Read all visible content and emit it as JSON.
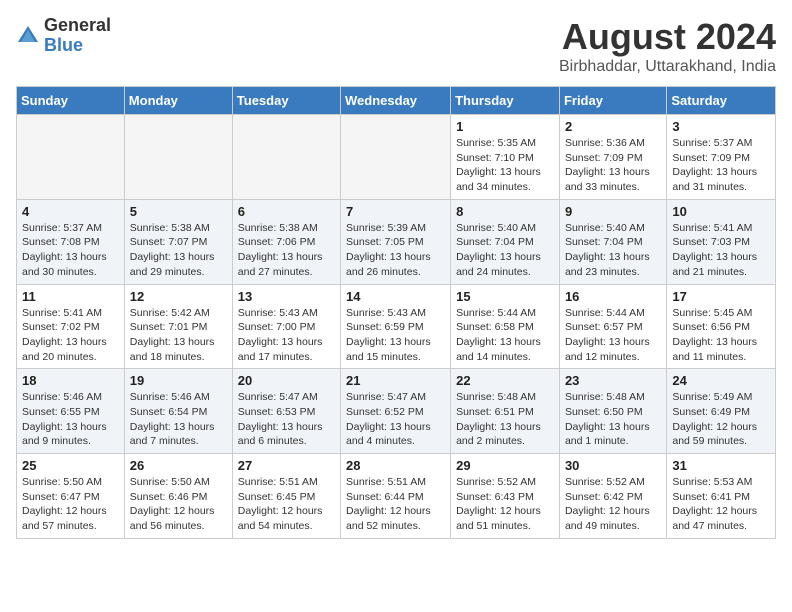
{
  "logo": {
    "general": "General",
    "blue": "Blue"
  },
  "title": {
    "month_year": "August 2024",
    "location": "Birbhaddar, Uttarakhand, India"
  },
  "days_of_week": [
    "Sunday",
    "Monday",
    "Tuesday",
    "Wednesday",
    "Thursday",
    "Friday",
    "Saturday"
  ],
  "weeks": [
    {
      "days": [
        {
          "num": "",
          "info": ""
        },
        {
          "num": "",
          "info": ""
        },
        {
          "num": "",
          "info": ""
        },
        {
          "num": "",
          "info": ""
        },
        {
          "num": "1",
          "info": "Sunrise: 5:35 AM\nSunset: 7:10 PM\nDaylight: 13 hours\nand 34 minutes."
        },
        {
          "num": "2",
          "info": "Sunrise: 5:36 AM\nSunset: 7:09 PM\nDaylight: 13 hours\nand 33 minutes."
        },
        {
          "num": "3",
          "info": "Sunrise: 5:37 AM\nSunset: 7:09 PM\nDaylight: 13 hours\nand 31 minutes."
        }
      ]
    },
    {
      "days": [
        {
          "num": "4",
          "info": "Sunrise: 5:37 AM\nSunset: 7:08 PM\nDaylight: 13 hours\nand 30 minutes."
        },
        {
          "num": "5",
          "info": "Sunrise: 5:38 AM\nSunset: 7:07 PM\nDaylight: 13 hours\nand 29 minutes."
        },
        {
          "num": "6",
          "info": "Sunrise: 5:38 AM\nSunset: 7:06 PM\nDaylight: 13 hours\nand 27 minutes."
        },
        {
          "num": "7",
          "info": "Sunrise: 5:39 AM\nSunset: 7:05 PM\nDaylight: 13 hours\nand 26 minutes."
        },
        {
          "num": "8",
          "info": "Sunrise: 5:40 AM\nSunset: 7:04 PM\nDaylight: 13 hours\nand 24 minutes."
        },
        {
          "num": "9",
          "info": "Sunrise: 5:40 AM\nSunset: 7:04 PM\nDaylight: 13 hours\nand 23 minutes."
        },
        {
          "num": "10",
          "info": "Sunrise: 5:41 AM\nSunset: 7:03 PM\nDaylight: 13 hours\nand 21 minutes."
        }
      ]
    },
    {
      "days": [
        {
          "num": "11",
          "info": "Sunrise: 5:41 AM\nSunset: 7:02 PM\nDaylight: 13 hours\nand 20 minutes."
        },
        {
          "num": "12",
          "info": "Sunrise: 5:42 AM\nSunset: 7:01 PM\nDaylight: 13 hours\nand 18 minutes."
        },
        {
          "num": "13",
          "info": "Sunrise: 5:43 AM\nSunset: 7:00 PM\nDaylight: 13 hours\nand 17 minutes."
        },
        {
          "num": "14",
          "info": "Sunrise: 5:43 AM\nSunset: 6:59 PM\nDaylight: 13 hours\nand 15 minutes."
        },
        {
          "num": "15",
          "info": "Sunrise: 5:44 AM\nSunset: 6:58 PM\nDaylight: 13 hours\nand 14 minutes."
        },
        {
          "num": "16",
          "info": "Sunrise: 5:44 AM\nSunset: 6:57 PM\nDaylight: 13 hours\nand 12 minutes."
        },
        {
          "num": "17",
          "info": "Sunrise: 5:45 AM\nSunset: 6:56 PM\nDaylight: 13 hours\nand 11 minutes."
        }
      ]
    },
    {
      "days": [
        {
          "num": "18",
          "info": "Sunrise: 5:46 AM\nSunset: 6:55 PM\nDaylight: 13 hours\nand 9 minutes."
        },
        {
          "num": "19",
          "info": "Sunrise: 5:46 AM\nSunset: 6:54 PM\nDaylight: 13 hours\nand 7 minutes."
        },
        {
          "num": "20",
          "info": "Sunrise: 5:47 AM\nSunset: 6:53 PM\nDaylight: 13 hours\nand 6 minutes."
        },
        {
          "num": "21",
          "info": "Sunrise: 5:47 AM\nSunset: 6:52 PM\nDaylight: 13 hours\nand 4 minutes."
        },
        {
          "num": "22",
          "info": "Sunrise: 5:48 AM\nSunset: 6:51 PM\nDaylight: 13 hours\nand 2 minutes."
        },
        {
          "num": "23",
          "info": "Sunrise: 5:48 AM\nSunset: 6:50 PM\nDaylight: 13 hours\nand 1 minute."
        },
        {
          "num": "24",
          "info": "Sunrise: 5:49 AM\nSunset: 6:49 PM\nDaylight: 12 hours\nand 59 minutes."
        }
      ]
    },
    {
      "days": [
        {
          "num": "25",
          "info": "Sunrise: 5:50 AM\nSunset: 6:47 PM\nDaylight: 12 hours\nand 57 minutes."
        },
        {
          "num": "26",
          "info": "Sunrise: 5:50 AM\nSunset: 6:46 PM\nDaylight: 12 hours\nand 56 minutes."
        },
        {
          "num": "27",
          "info": "Sunrise: 5:51 AM\nSunset: 6:45 PM\nDaylight: 12 hours\nand 54 minutes."
        },
        {
          "num": "28",
          "info": "Sunrise: 5:51 AM\nSunset: 6:44 PM\nDaylight: 12 hours\nand 52 minutes."
        },
        {
          "num": "29",
          "info": "Sunrise: 5:52 AM\nSunset: 6:43 PM\nDaylight: 12 hours\nand 51 minutes."
        },
        {
          "num": "30",
          "info": "Sunrise: 5:52 AM\nSunset: 6:42 PM\nDaylight: 12 hours\nand 49 minutes."
        },
        {
          "num": "31",
          "info": "Sunrise: 5:53 AM\nSunset: 6:41 PM\nDaylight: 12 hours\nand 47 minutes."
        }
      ]
    }
  ]
}
